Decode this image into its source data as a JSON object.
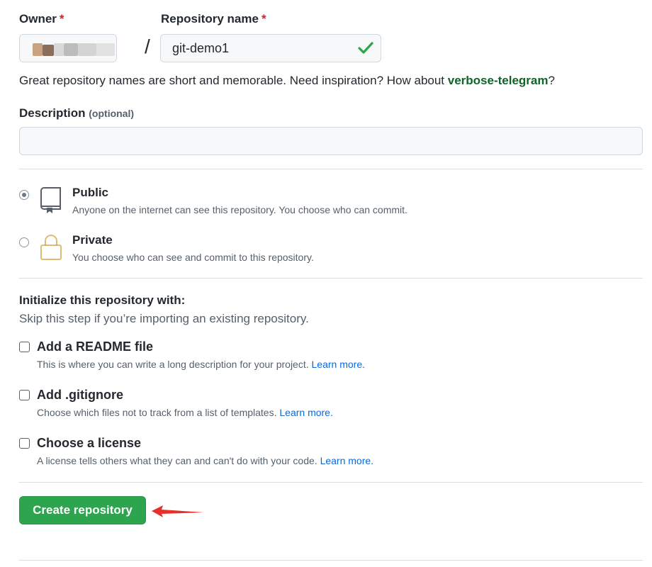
{
  "owner": {
    "label": "Owner",
    "required_mark": "*"
  },
  "repo_name": {
    "label": "Repository name",
    "required_mark": "*",
    "value": "git-demo1",
    "separator": "/"
  },
  "hint": {
    "prefix": "Great repository names are short and memorable. Need inspiration? How about ",
    "suggestion": "verbose-telegram",
    "suffix": "?"
  },
  "description": {
    "label": "Description",
    "optional": "(optional)",
    "value": ""
  },
  "visibility": {
    "selected": "public",
    "public": {
      "title": "Public",
      "desc": "Anyone on the internet can see this repository. You choose who can commit.",
      "icon": "repo-icon"
    },
    "private": {
      "title": "Private",
      "desc": "You choose who can see and commit to this repository.",
      "icon": "lock-icon"
    }
  },
  "init": {
    "title": "Initialize this repository with:",
    "subtitle": "Skip this step if you’re importing an existing repository.",
    "readme": {
      "label": "Add a README file",
      "desc": "This is where you can write a long description for your project.",
      "link": "Learn more."
    },
    "gitignore": {
      "label": "Add .gitignore",
      "desc": "Choose which files not to track from a list of templates.",
      "link": "Learn more."
    },
    "license": {
      "label": "Choose a license",
      "desc": "A license tells others what they can and can't do with your code.",
      "link": "Learn more."
    }
  },
  "submit": {
    "label": "Create repository"
  },
  "colors": {
    "primary_button": "#2da44e",
    "link": "#0969da",
    "suggestion": "#116329",
    "required": "#cf222e",
    "arrow": "#e5302b",
    "valid_check": "#2da44e"
  }
}
